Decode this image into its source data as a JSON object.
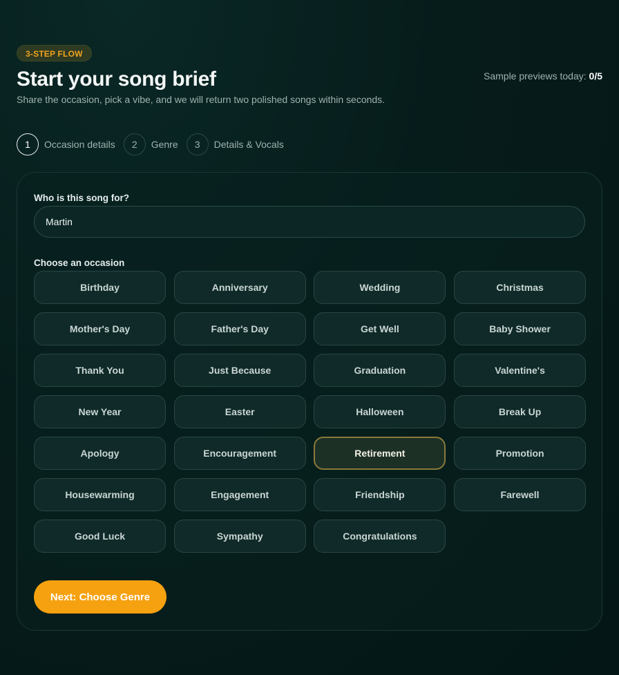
{
  "header": {
    "badge": "3-STEP FLOW",
    "title": "Start your song brief",
    "subtitle": "Share the occasion, pick a vibe, and we will return two polished songs within seconds.",
    "previews_label": "Sample previews today:",
    "previews_count": "0/5"
  },
  "steps": [
    {
      "number": "1",
      "label": "Occasion details",
      "active": true
    },
    {
      "number": "2",
      "label": "Genre",
      "active": false
    },
    {
      "number": "3",
      "label": "Details & Vocals",
      "active": false
    }
  ],
  "form": {
    "recipient_label": "Who is this song for?",
    "recipient_value": "Martin",
    "occasion_label": "Choose an occasion",
    "selected_occasion": "Retirement",
    "occasions": [
      "Birthday",
      "Anniversary",
      "Wedding",
      "Christmas",
      "Mother's Day",
      "Father's Day",
      "Get Well",
      "Baby Shower",
      "Thank You",
      "Just Because",
      "Graduation",
      "Valentine's",
      "New Year",
      "Easter",
      "Halloween",
      "Break Up",
      "Apology",
      "Encouragement",
      "Retirement",
      "Promotion",
      "Housewarming",
      "Engagement",
      "Friendship",
      "Farewell",
      "Good Luck",
      "Sympathy",
      "Congratulations"
    ],
    "next_button": "Next: Choose Genre"
  },
  "colors": {
    "accent": "#f6a10f",
    "background": "#061c1b",
    "selected_border": "#8a7a3a"
  }
}
